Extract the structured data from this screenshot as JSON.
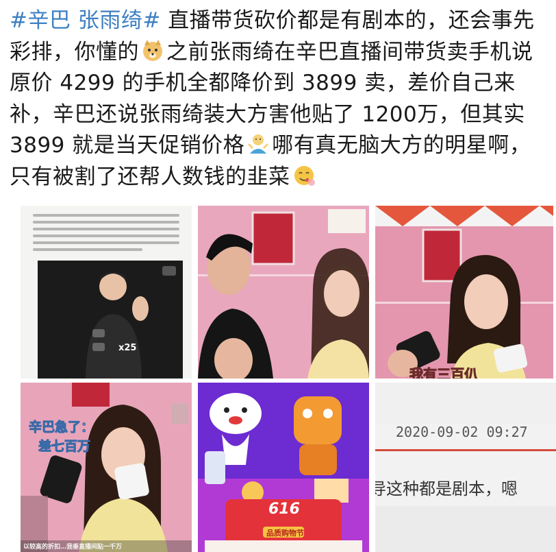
{
  "post": {
    "hashtag": "#辛巴 张雨绮#",
    "text_1": "直播带货砍价都是有剧本的，还会事先彩排，你懂的",
    "text_2": "之前张雨绮在辛巴直播间带货卖手机说原价 4299 的手机全都降价到 3899 卖，差价自己来补，辛巴还说张雨绮装大方害他贴了 1200万，但其实 3899 就是当天促销价格",
    "text_3": "哪有真无脑大方的明星啊，只有被割了还帮人数钱的韭菜",
    "emoji_1": "doge-emoji",
    "emoji_2": "shrug-emoji",
    "emoji_3": "yum-emoji"
  },
  "images": {
    "img1_badge": "x25",
    "img3_caption": "我有三百仈",
    "img4_caption_line1": "辛巴急了：",
    "img4_caption_line2": "差七百万",
    "img4_bottom": "以较高的折扣…我垂直播间贴一千万",
    "img5_logo": "616",
    "img5_banner": "品质购物节",
    "img6_timestamp": "2020-09-02 09:27",
    "img6_text": "导这种都是剧本，嗯"
  }
}
